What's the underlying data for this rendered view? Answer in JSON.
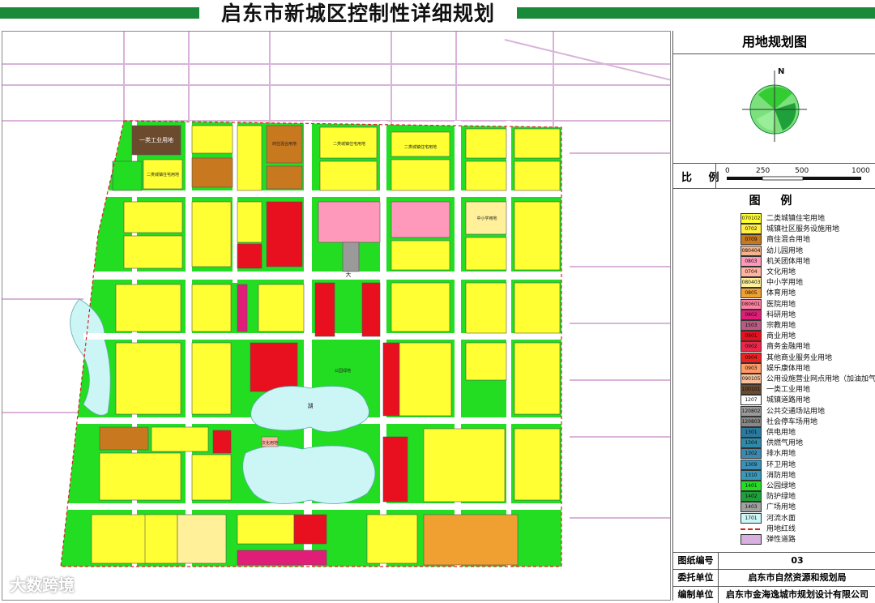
{
  "header": {
    "title": "启东市新城区控制性详细规划"
  },
  "map": {
    "labels": {
      "lake": "湖",
      "road_da": "大",
      "industrial": "一类工业用地",
      "residential": "二类城镇住宅用地",
      "school": "中小学用地",
      "commercial": "商住混合用地",
      "park": "公园绿地",
      "culture": "文化用地"
    }
  },
  "panel": {
    "title": "用地规划图",
    "north": "N",
    "scale_label": "比 例",
    "scale_ticks": [
      "0",
      "250",
      "500",
      "1000"
    ],
    "legend_title": "图 例",
    "legend": [
      {
        "code": "070102",
        "name": "二类城镇住宅用地",
        "color": "#ffff33"
      },
      {
        "code": "0702",
        "name": "城镇社区服务设施用地",
        "color": "#ffee44"
      },
      {
        "code": "0709",
        "name": "商住混合用地",
        "color": "#c8781e"
      },
      {
        "code": "080404",
        "name": "幼儿园用地",
        "color": "#f2b48c"
      },
      {
        "code": "0803",
        "name": "机关团体用地",
        "color": "#ff99bb"
      },
      {
        "code": "0704",
        "name": "文化用地",
        "color": "#ffb3a0"
      },
      {
        "code": "080403",
        "name": "中小学用地",
        "color": "#fff099"
      },
      {
        "code": "0805",
        "name": "体育用地",
        "color": "#f0a030"
      },
      {
        "code": "080601",
        "name": "医院用地",
        "color": "#ff80a0"
      },
      {
        "code": "0802",
        "name": "科研用地",
        "color": "#e01e78"
      },
      {
        "code": "1503",
        "name": "宗教用地",
        "color": "#b85b80"
      },
      {
        "code": "0901",
        "name": "商业用地",
        "color": "#e8101e"
      },
      {
        "code": "0902",
        "name": "商务金融用地",
        "color": "#e8284a"
      },
      {
        "code": "0904",
        "name": "其他商业服务业用地",
        "color": "#ee2020"
      },
      {
        "code": "0903",
        "name": "娱乐康体用地",
        "color": "#ff9966"
      },
      {
        "code": "090105",
        "name": "公用设施营业网点用地（加油加气站用地）",
        "color": "#f5c09a"
      },
      {
        "code": "100101",
        "name": "一类工业用地",
        "color": "#6b4a2e"
      },
      {
        "code": "1207",
        "name": "城镇道路用地",
        "color": "#ffffff"
      },
      {
        "code": "120802",
        "name": "公共交通场站用地",
        "color": "#9a9a9a"
      },
      {
        "code": "120803",
        "name": "社会停车场用地",
        "color": "#888888"
      },
      {
        "code": "1301",
        "name": "供电用地",
        "color": "#2a7aa0"
      },
      {
        "code": "1304",
        "name": "供燃气用地",
        "color": "#2e8aa8"
      },
      {
        "code": "1302",
        "name": "排水用地",
        "color": "#3b88b0"
      },
      {
        "code": "1309",
        "name": "环卫用地",
        "color": "#3a90b8"
      },
      {
        "code": "1310",
        "name": "消防用地",
        "color": "#3898b8"
      },
      {
        "code": "1401",
        "name": "公园绿地",
        "color": "#22dd22"
      },
      {
        "code": "1402",
        "name": "防护绿地",
        "color": "#1fa03a"
      },
      {
        "code": "1403",
        "name": "广场用地",
        "color": "#a0a0a0"
      },
      {
        "code": "1701",
        "name": "河流水面",
        "color": "#ccf5f5"
      },
      {
        "code": "",
        "name": "用地红线",
        "color": "#e02020"
      },
      {
        "code": "",
        "name": "弹性道路",
        "color": "#d8b0e0"
      }
    ],
    "info": [
      {
        "key": "图纸编号",
        "value": "03"
      },
      {
        "key": "委托单位",
        "value": "启东市自然资源和规划局"
      },
      {
        "key": "编制单位",
        "value": "启东市金海逸城市规划设计有限公司"
      }
    ]
  },
  "watermark": "大数跨境"
}
